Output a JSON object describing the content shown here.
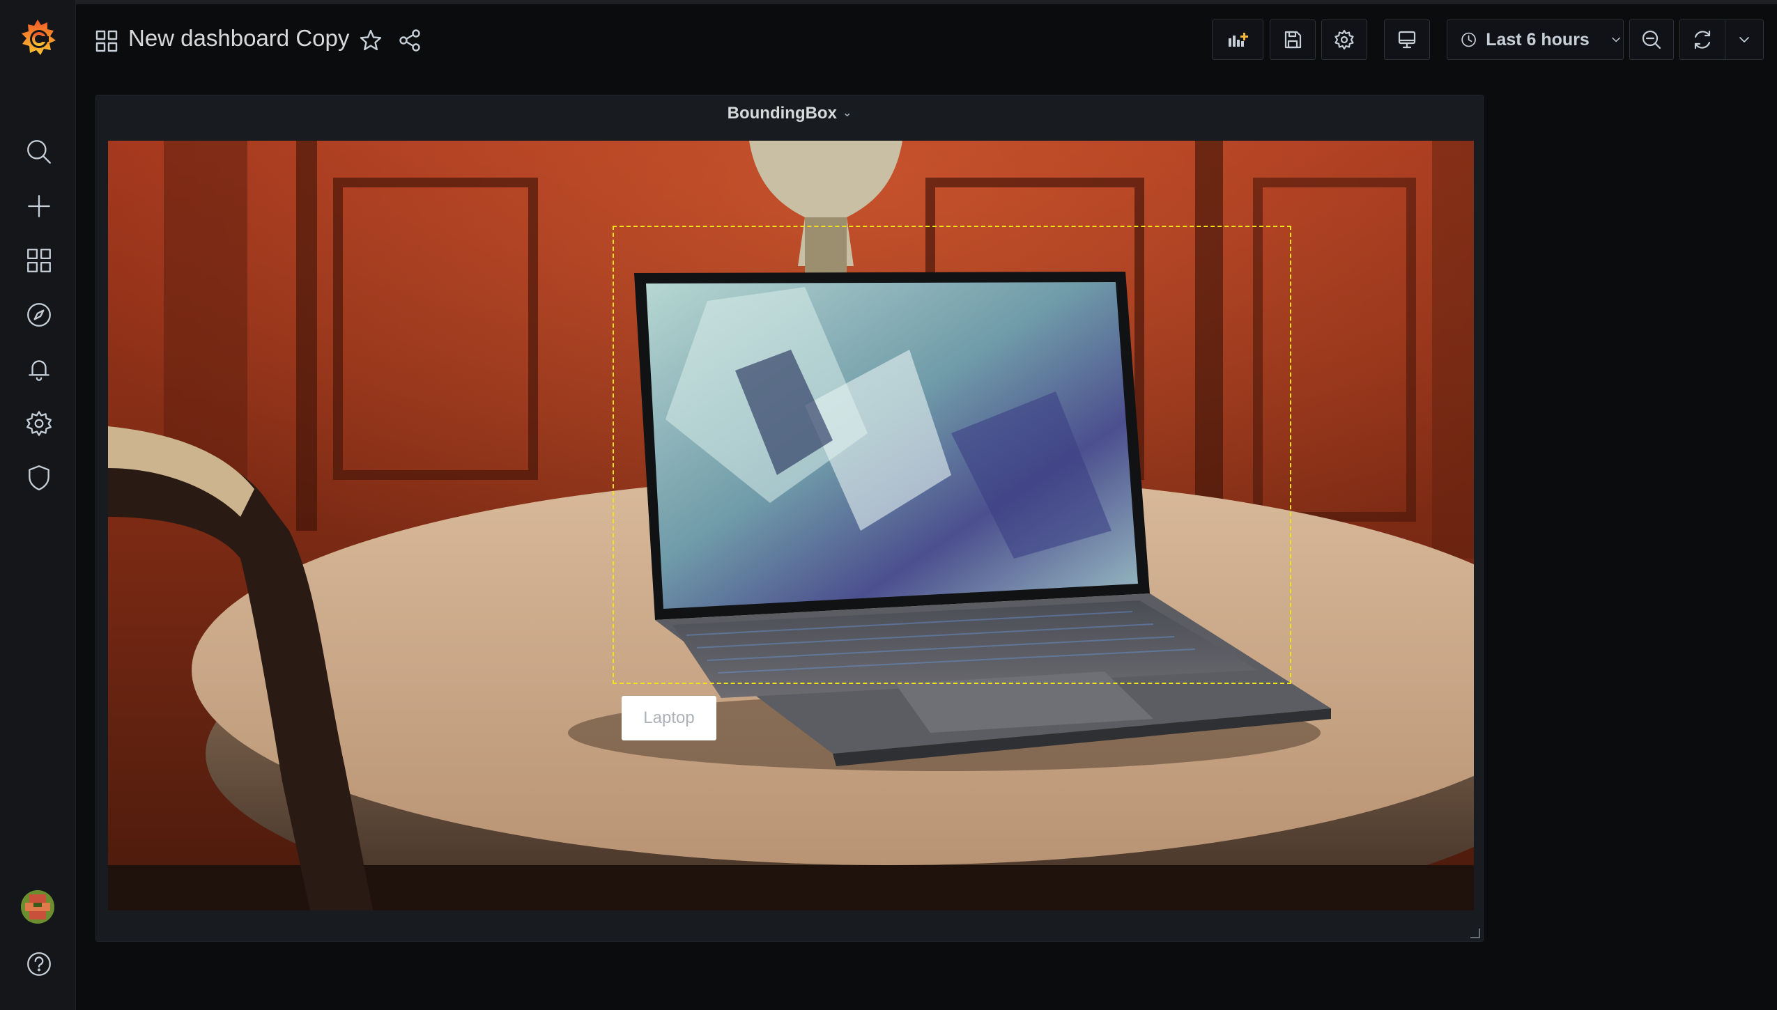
{
  "header": {
    "dashboard_title": "New dashboard Copy",
    "time_range_label": "Last 6 hours"
  },
  "sidebar": {
    "items": [
      {
        "icon": "search-icon"
      },
      {
        "icon": "plus-icon"
      },
      {
        "icon": "dashboards-icon"
      },
      {
        "icon": "explore-compass-icon"
      },
      {
        "icon": "alerting-bell-icon"
      },
      {
        "icon": "configuration-gear-icon"
      },
      {
        "icon": "shield-icon"
      }
    ],
    "bottom": [
      {
        "icon": "user-avatar"
      },
      {
        "icon": "help-icon"
      }
    ]
  },
  "toolbar": {
    "buttons": [
      "add-panel-icon",
      "save-icon",
      "settings-gear-icon",
      "tv-mode-icon",
      "zoom-out-icon",
      "refresh-icon",
      "chevron-down-icon"
    ]
  },
  "panel": {
    "title": "BoundingBox",
    "detection": {
      "label": "Laptop",
      "box_color": "#f2e318"
    }
  },
  "colors": {
    "background": "#0b0c0e",
    "sidebar": "#141619",
    "panel": "#181b1f",
    "logo_orange": "#f05a28"
  }
}
